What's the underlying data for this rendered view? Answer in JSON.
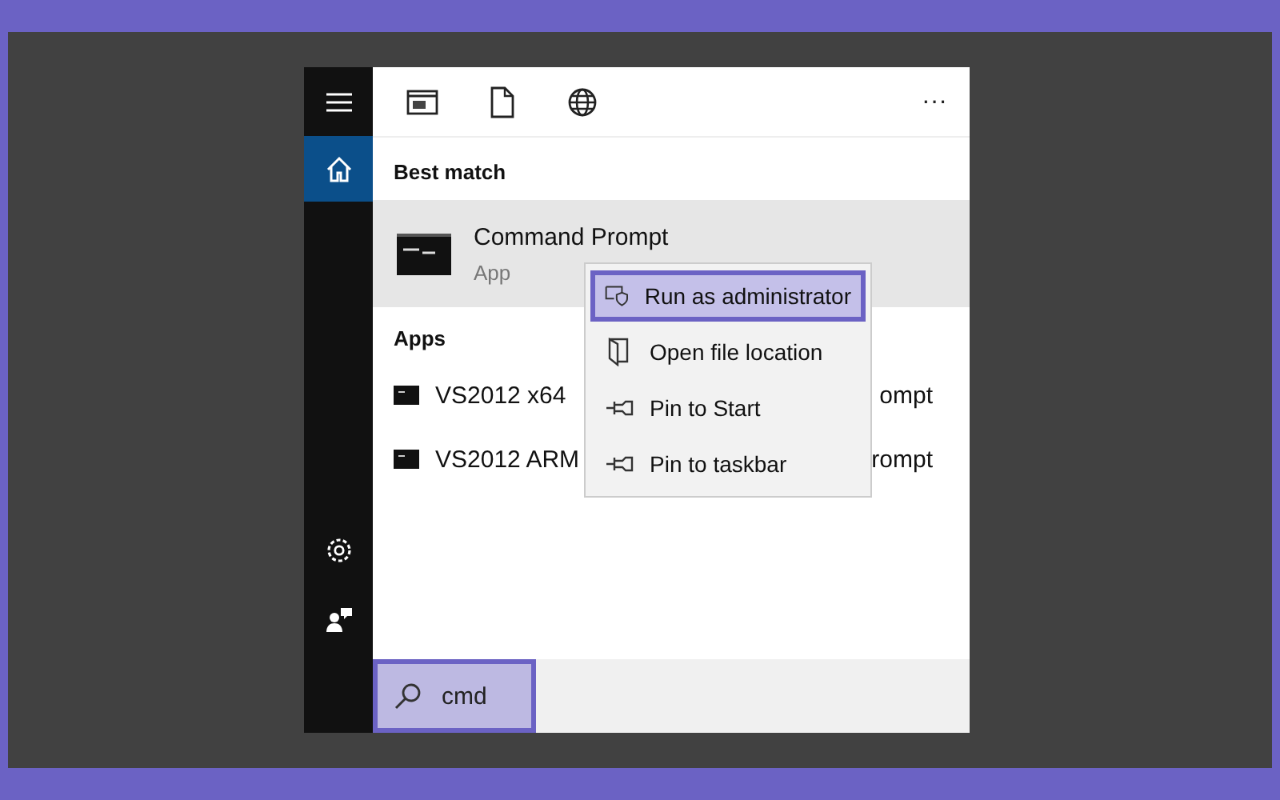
{
  "sidebar": {
    "items": [
      {
        "kind": "menu",
        "selected": false
      },
      {
        "kind": "home",
        "selected": true
      },
      {
        "kind": "settings",
        "selected": false
      },
      {
        "kind": "feedback",
        "selected": false
      }
    ]
  },
  "toolbar": {
    "tabs": [
      {
        "kind": "apps"
      },
      {
        "kind": "documents"
      },
      {
        "kind": "web"
      }
    ],
    "more": "···"
  },
  "best_match": {
    "heading": "Best match",
    "title": "Command Prompt",
    "subtitle": "App",
    "selected": true
  },
  "apps": {
    "heading": "Apps",
    "items": [
      {
        "name": "VS2012 x64",
        "tail": "ompt"
      },
      {
        "name": "VS2012 ARM",
        "tail": "rompt"
      }
    ]
  },
  "context_menu": [
    {
      "kind": "admin",
      "label": "Run as administrator",
      "selected": true
    },
    {
      "kind": "folder",
      "label": "Open file location",
      "selected": false
    },
    {
      "kind": "pin",
      "label": "Pin to Start",
      "selected": false
    },
    {
      "kind": "pin",
      "label": "Pin to taskbar",
      "selected": false
    }
  ],
  "search": {
    "value": "cmd",
    "highlighted": true
  }
}
